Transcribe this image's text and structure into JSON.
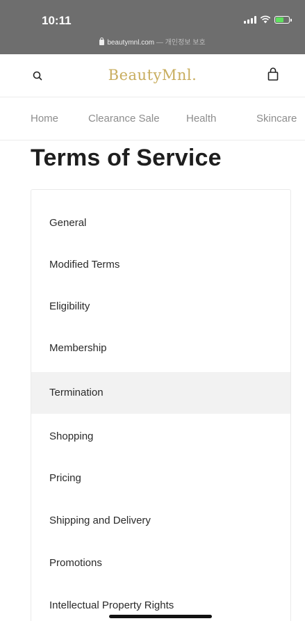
{
  "status_bar": {
    "time": "10:11",
    "url": "beautymnl.com",
    "url_suffix": "— 개인정보 보호",
    "battery_level": 0.6
  },
  "header": {
    "logo": "BeautyMnl."
  },
  "nav": {
    "items": [
      "Home",
      "Clearance Sale",
      "Health",
      "Skincare"
    ]
  },
  "page": {
    "title": "Terms of Service"
  },
  "menu": {
    "active_index": 4,
    "items": [
      "General",
      "Modified Terms",
      "Eligibility",
      "Membership",
      "Termination",
      "Shopping",
      "Pricing",
      "Shipping and Delivery",
      "Promotions",
      "Intellectual Property Rights"
    ]
  },
  "colors": {
    "status_bar": "#6e6e6e",
    "logo": "#c8ad5e",
    "nav_text": "#8d8d8d",
    "active_row": "#f2f2f2"
  }
}
